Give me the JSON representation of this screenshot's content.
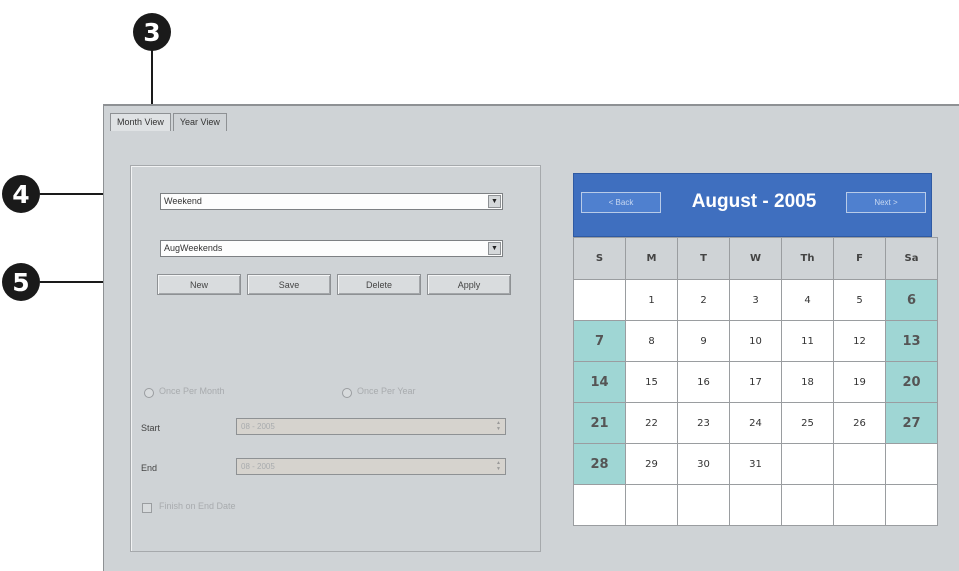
{
  "callouts": [
    "3",
    "4",
    "5"
  ],
  "tabs": [
    "Month View",
    "Year View"
  ],
  "schedule": {
    "type_value": "Weekend",
    "name_value": "AugWeekends",
    "buttons": {
      "new": "New",
      "save": "Save",
      "delete": "Delete",
      "apply": "Apply"
    },
    "radio_once_per_month": "Once Per Month",
    "radio_once_per_year": "Once Per Year",
    "start_label": "Start",
    "start_value": "08 - 2005",
    "end_label": "End",
    "end_value": "08 - 2005",
    "finish_checkbox": "Finish on End Date"
  },
  "calendar": {
    "back": "< Back",
    "title": "August - 2005",
    "next": "Next >",
    "days_of_week": [
      "S",
      "M",
      "T",
      "W",
      "Th",
      "F",
      "Sa"
    ],
    "weeks": [
      [
        "",
        "1",
        "2",
        "3",
        "4",
        "5",
        "6"
      ],
      [
        "7",
        "8",
        "9",
        "10",
        "11",
        "12",
        "13"
      ],
      [
        "14",
        "15",
        "16",
        "17",
        "18",
        "19",
        "20"
      ],
      [
        "21",
        "22",
        "23",
        "24",
        "25",
        "26",
        "27"
      ],
      [
        "28",
        "29",
        "30",
        "31",
        "",
        "",
        ""
      ],
      [
        "",
        "",
        "",
        "",
        "",
        "",
        ""
      ]
    ],
    "highlight_color": "#9fd6d4",
    "header_color": "#3f6fbf"
  }
}
